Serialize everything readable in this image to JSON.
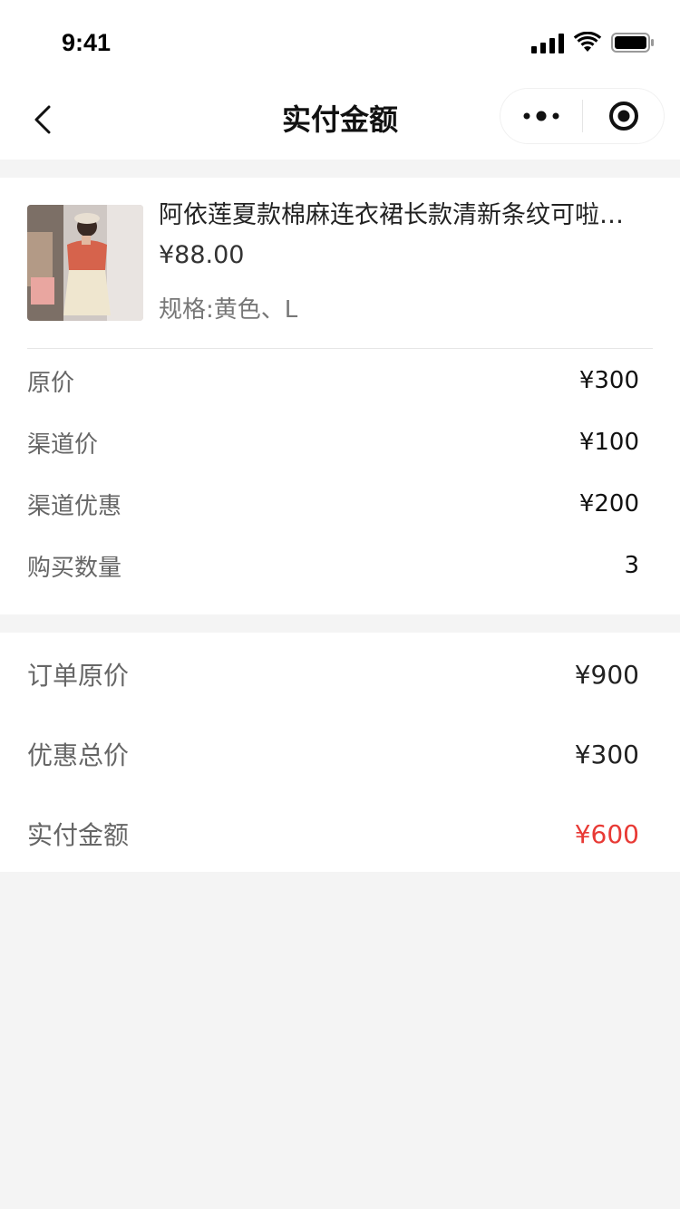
{
  "status_bar": {
    "time": "9:41"
  },
  "nav": {
    "title": "实付金额"
  },
  "product": {
    "name": "阿依莲夏款棉麻连衣裙长款清新条纹可啦…",
    "price": "¥88.00",
    "spec": "规格:黄色、L"
  },
  "details": [
    {
      "label": "原价",
      "value": "¥300"
    },
    {
      "label": "渠道价",
      "value": "¥100"
    },
    {
      "label": "渠道优惠",
      "value": "¥200"
    },
    {
      "label": "购买数量",
      "value": "3"
    }
  ],
  "totals": [
    {
      "label": "订单原价",
      "value": "¥900"
    },
    {
      "label": "优惠总价",
      "value": "¥300"
    },
    {
      "label": "实付金额",
      "value": "¥600"
    }
  ],
  "colors": {
    "accent": "#e83a35",
    "background": "#f4f4f4"
  }
}
